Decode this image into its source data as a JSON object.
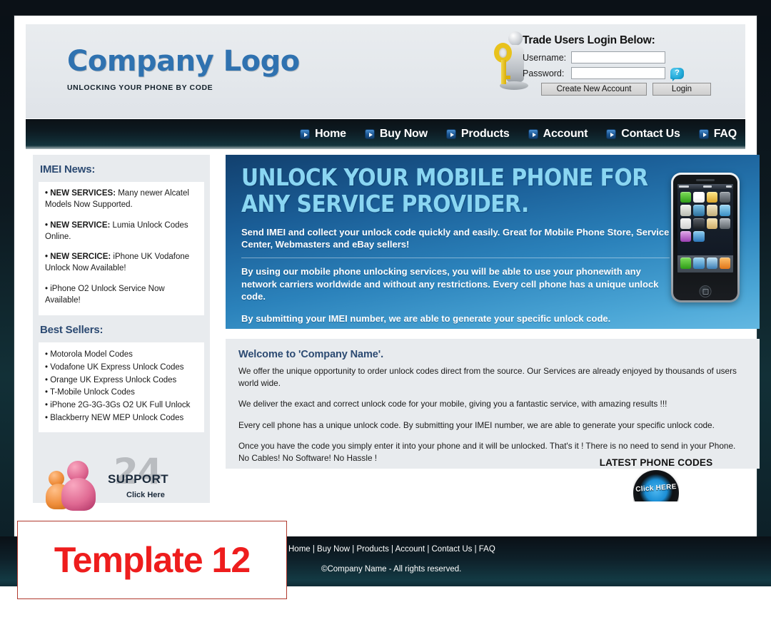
{
  "brand": {
    "logo_first_word": "Company",
    "logo_second_word": "Logo",
    "tagline": "UNLOCKING YOUR PHONE BY CODE"
  },
  "login": {
    "heading": "Trade Users Login Below:",
    "username_label": "Username:",
    "password_label": "Password:",
    "username_value": "",
    "password_value": "",
    "username_placeholder": "",
    "password_placeholder": "",
    "help_glyph": "?",
    "create_account_label": "Create New Account",
    "login_label": "Login"
  },
  "nav": {
    "items": [
      {
        "label": "Home"
      },
      {
        "label": "Buy Now"
      },
      {
        "label": "Products"
      },
      {
        "label": "Account"
      },
      {
        "label": "Contact Us"
      },
      {
        "label": "FAQ"
      }
    ]
  },
  "sidebar": {
    "news_title": "IMEI News:",
    "news_items": [
      {
        "lead": "• NEW SERVICES:",
        "text": " Many newer Alcatel Models Now Supported."
      },
      {
        "lead": "• NEW SERVICE:",
        "text": " Lumia Unlock Codes Online."
      },
      {
        "lead": "• NEW SERCICE:",
        "text": " iPhone UK Vodafone Unlock Now Available!"
      },
      {
        "lead": "",
        "text": "• iPhone O2 Unlock Service Now Available!"
      }
    ],
    "best_sellers_title": "Best Sellers:",
    "best_sellers": [
      "• Motorola Model Codes",
      "• Vodafone UK Express Unlock Codes",
      "• Orange UK Express Unlock Codes",
      "• T-Mobile Unlock Codes",
      "• iPhone 2G-3G-3Gs O2 UK Full Unlock",
      "• Blackberry NEW MEP Unlock Codes"
    ],
    "support": {
      "number": "24",
      "word": "SUPPORT",
      "click": "Click Here"
    }
  },
  "hero": {
    "headline": "UNLOCK YOUR MOBILE PHONE FOR ANY SERVICE PROVIDER.",
    "lead": "Send IMEI and collect your unlock code quickly and easily. Great for Mobile Phone Store, Service Center, Webmasters and eBay sellers!",
    "paragraph_1": "By using our mobile phone unlocking services, you will be able to use your phonewith any network carriers worldwide and without any restrictions. Every cell phone has a unique unlock code.",
    "paragraph_2": "By submitting your IMEI number, we are able to generate your specific unlock code."
  },
  "welcome": {
    "title": "Welcome to 'Company Name'.",
    "paragraphs": [
      "We offer the unique opportunity to order unlock codes direct from the source. Our Services are already enjoyed by thousands of users world wide.",
      "We deliver the exact and correct unlock code for your mobile, giving you a fantastic service, with amazing results !!!",
      "Every cell phone has a unique unlock code. By submitting your IMEI number, we are able to generate your specific unlock code.",
      "Once you have the code you simply enter it into your phone and it will be unlocked. That's it ! There is no need to send in your Phone. No Cables! No Software! No Hassle !"
    ]
  },
  "latest": {
    "title": "LATEST PHONE CODES",
    "badge_label": "Click HERE"
  },
  "footer": {
    "links": "Home | Buy Now | Products | Account | Contact Us | FAQ",
    "copyright": "©Company Name - All rights reserved."
  },
  "overlay": {
    "template_label": "Template 12"
  },
  "colors": {
    "accent_blue": "#2f72b0",
    "hero_headline": "#8ad6f2",
    "heading_blue": "#2c4a72",
    "template_red": "#ee1d1d",
    "panel_grey": "#e8ebee"
  }
}
